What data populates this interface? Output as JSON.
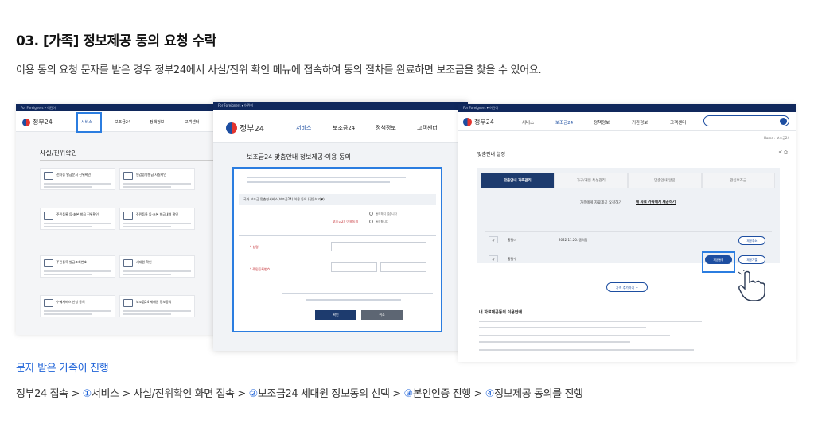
{
  "heading": "03. [가족] 정보제공 동의 요청 수락",
  "description": "이용 동의 요청 문자를 받은 경우 정부24에서 사실/진위 확인 메뉴에 접속하여 동의 절차를 완료하면 보조금을 찾을 수 있어요.",
  "shot1": {
    "topbar": "For Foreigners ▾   어린이",
    "logo": "정부24",
    "nav": [
      "서비스",
      "보조금24",
      "정책정보",
      "고객센터"
    ],
    "page_title": "사실/진위확인",
    "cards": [
      "전자증 발급문서 진위확인",
      "인감증명발급 사실확인",
      "주민등록 등·초본 발급 진위확인",
      "주민등록 등·초본 발급내역 확인",
      "주민등록 발급조회번호",
      "세대원 확인",
      "수혜서비스 신청 동의",
      "보조금24 세대원 정보동의"
    ]
  },
  "shot2": {
    "topbar": "For Foreigners ▾   어린이",
    "logo": "정부24",
    "nav": [
      "서비스",
      "보조금24",
      "정책정보",
      "고객센터"
    ],
    "page_title": "보조금24 맞춤안내 정보제공·이용 동의",
    "section": "국가 보조금 맞춤형서비스(보조금24) 이용 동의 (전문보기▼)",
    "agree_label": "보조금24 이용동의",
    "agree_option": "동의합니다",
    "disagree_option": "동의하지 않습니다",
    "name_label": "* 성명",
    "rrn_label": "* 주민등록번호",
    "confirm": "확인",
    "cancel": "취소"
  },
  "shot3": {
    "topbar": "For Foreigners ▾   어린이",
    "logo": "정부24",
    "nav": [
      "서비스",
      "보조금24",
      "정책정보",
      "기관정보",
      "고객센터"
    ],
    "breadcrumb": "Home › 보조금24",
    "page_title": "맞춤안내 설정",
    "tabs": [
      "맞춤안내 가족관리",
      "가구/개인 특성관리",
      "맞춤안내 알림",
      "관심보조금"
    ],
    "subtabs": [
      "가족에게 자료제공 요청하기",
      "내 자료 가족에게 제공하기"
    ],
    "rows": [
      {
        "rel": "자",
        "name": "홍길녀",
        "date": "2022.11.20. 동의함",
        "actions": [
          "제공취소"
        ]
      },
      {
        "rel": "자",
        "name": "홍길수",
        "date": "",
        "actions": [
          "제공동의",
          "제공거절"
        ]
      }
    ],
    "add_button": "가족 추가하기 +",
    "info_title": "내 자료제공동의 이용안내"
  },
  "caption_title": "문자 받은 가족이 진행",
  "caption": {
    "prefix": "정부24 접속 > ",
    "n1": "①",
    "s1": "서비스 > 사실/진위확인 화면 접속 > ",
    "n2": "②",
    "s2": "보조금24 세대원 정보동의 선택 > ",
    "n3": "③",
    "s3": "본인인증 진행 > ",
    "n4": "④",
    "s4": "정보제공 동의를 진행"
  },
  "colors": {
    "accent": "#1f63d8",
    "highlight": "#2b7de0",
    "navy": "#1d3b6e"
  }
}
